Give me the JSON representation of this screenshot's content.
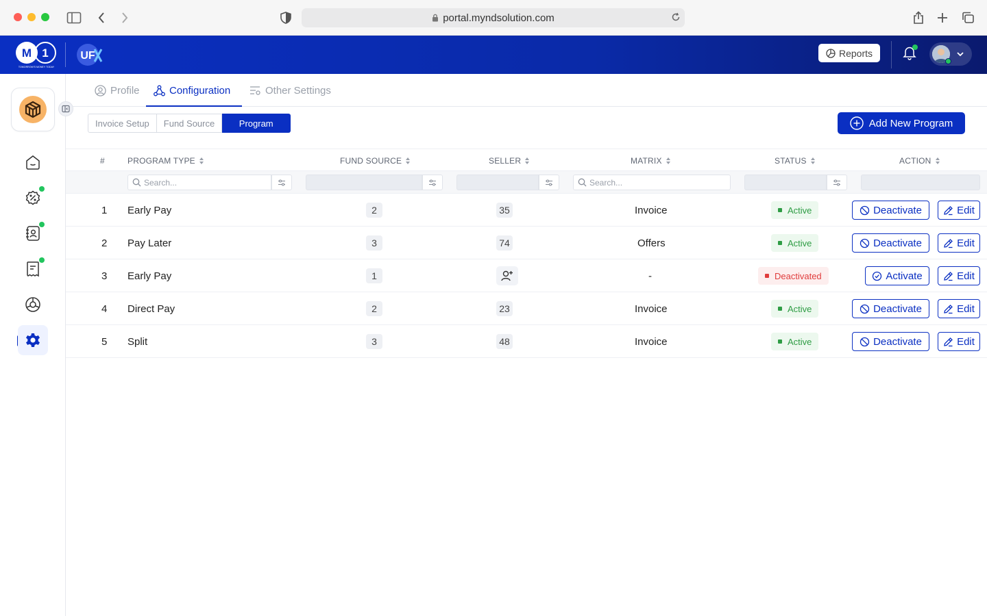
{
  "browser": {
    "url": "portal.myndsolution.com"
  },
  "header": {
    "logo_text": "M1",
    "logo_tagline": "TOMORROW'S MONEY TODAY",
    "product_logo_text": "UFX",
    "reports_label": "Reports",
    "accent_color": "#0a2fc2"
  },
  "main_tabs": [
    {
      "label": "Profile",
      "icon": "user-circle-icon",
      "active": false
    },
    {
      "label": "Configuration",
      "icon": "network-icon",
      "active": true
    },
    {
      "label": "Other Settings",
      "icon": "settings-list-icon",
      "active": false
    }
  ],
  "sub_tabs": [
    {
      "label": "Invoice Setup",
      "active": false
    },
    {
      "label": "Fund Source",
      "active": false
    },
    {
      "label": "Program",
      "active": true
    }
  ],
  "add_button_label": "Add New Program",
  "table": {
    "columns": [
      "#",
      "PROGRAM TYPE",
      "FUND SOURCE",
      "SELLER",
      "MATRIX",
      "STATUS",
      "ACTION"
    ],
    "filters": {
      "program_type_placeholder": "Search...",
      "matrix_placeholder": "Search..."
    },
    "rows": [
      {
        "index": "1",
        "program_type": "Early Pay",
        "fund_source": "2",
        "seller": "35",
        "matrix": "Invoice",
        "status": "Active",
        "action": "Deactivate",
        "edit": "Edit"
      },
      {
        "index": "2",
        "program_type": "Pay Later",
        "fund_source": "3",
        "seller": "74",
        "matrix": "Offers",
        "status": "Active",
        "action": "Deactivate",
        "edit": "Edit"
      },
      {
        "index": "3",
        "program_type": "Early Pay",
        "fund_source": "1",
        "seller": "",
        "matrix": "-",
        "status": "Deactivated",
        "action": "Activate",
        "edit": "Edit"
      },
      {
        "index": "4",
        "program_type": "Direct Pay",
        "fund_source": "2",
        "seller": "23",
        "matrix": "Invoice",
        "status": "Active",
        "action": "Deactivate",
        "edit": "Edit"
      },
      {
        "index": "5",
        "program_type": "Split",
        "fund_source": "3",
        "seller": "48",
        "matrix": "Invoice",
        "status": "Active",
        "action": "Deactivate",
        "edit": "Edit"
      }
    ]
  },
  "sidebar": {
    "items": [
      {
        "icon": "home-icon",
        "badge": false
      },
      {
        "icon": "discount-icon",
        "badge": true
      },
      {
        "icon": "contacts-icon",
        "badge": true
      },
      {
        "icon": "receipt-icon",
        "badge": true
      },
      {
        "icon": "aperture-icon",
        "badge": false
      },
      {
        "icon": "settings-icon",
        "badge": false,
        "active": true
      }
    ]
  }
}
